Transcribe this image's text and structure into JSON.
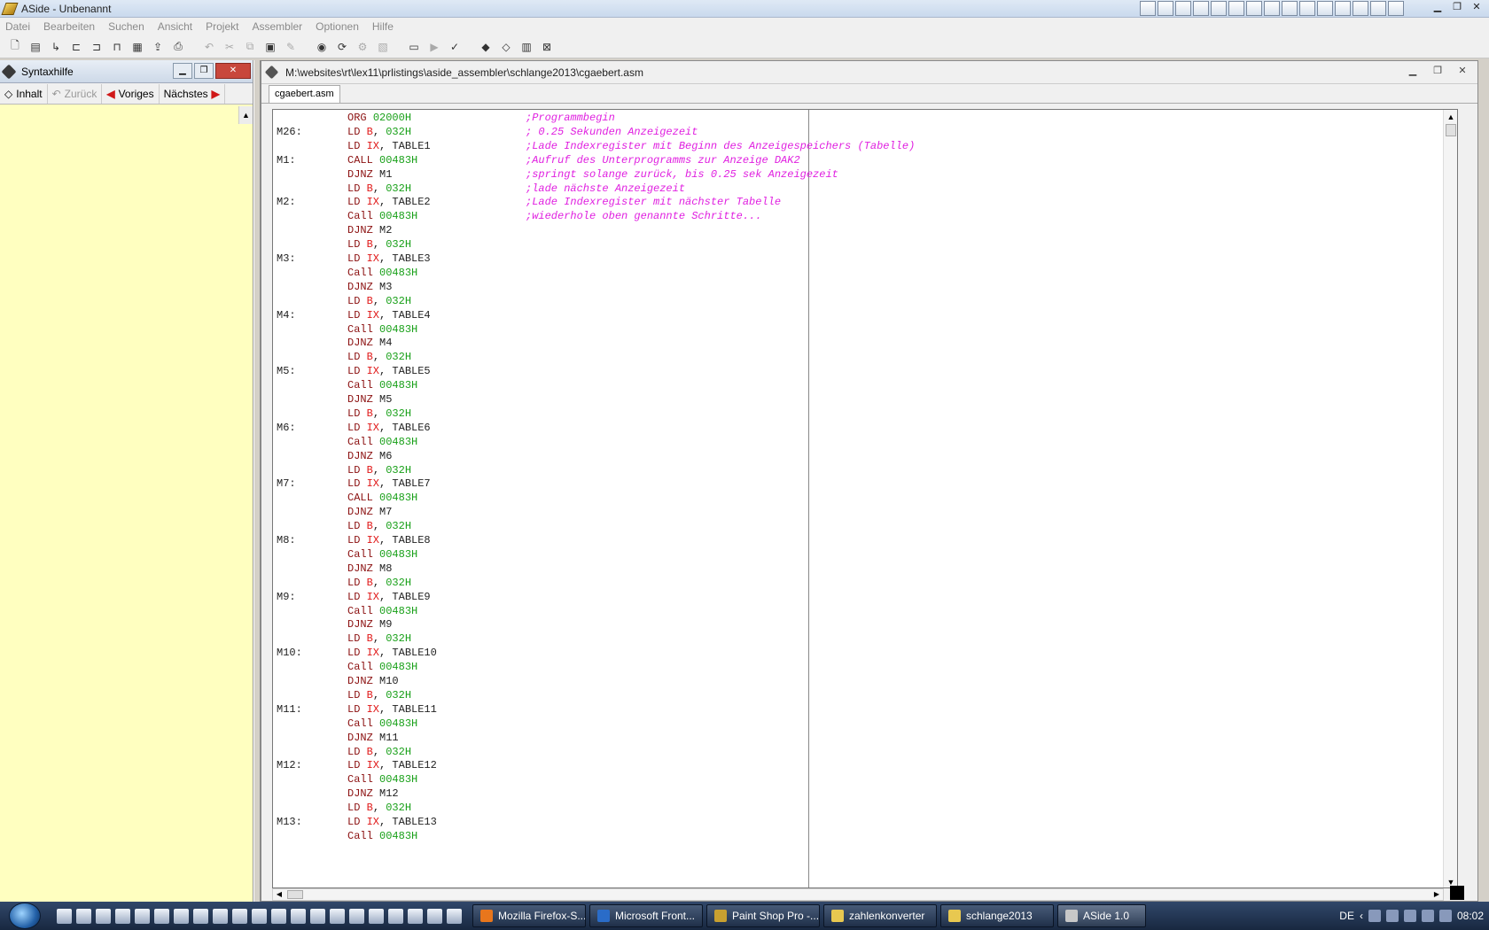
{
  "window": {
    "title": "ASide - Unbenannt"
  },
  "menu": [
    "Datei",
    "Bearbeiten",
    "Suchen",
    "Ansicht",
    "Projekt",
    "Assembler",
    "Optionen",
    "Hilfe"
  ],
  "syntax_panel": {
    "title": "Syntaxhilfe",
    "nav": {
      "contents": "Inhalt",
      "back": "Zurück",
      "previous": "Voriges",
      "next": "Nächstes"
    }
  },
  "editor": {
    "path": "M:\\websites\\rt\\lex11\\prlistings\\aside_assembler\\schlange2013\\cgaebert.asm",
    "tab": "cgaebert.asm",
    "lines": [
      {
        "label": "",
        "op": "ORG",
        "args": [
          {
            "t": "02000H",
            "c": "num"
          }
        ],
        "comment": ";Programmbegin"
      },
      {
        "label": "M26:",
        "op": "LD",
        "args": [
          {
            "t": "B",
            "c": "reg"
          },
          {
            "t": ", ",
            "c": "op"
          },
          {
            "t": "032H",
            "c": "num"
          }
        ],
        "comment": "; 0.25 Sekunden Anzeigezeit"
      },
      {
        "label": "",
        "op": "LD",
        "args": [
          {
            "t": "IX",
            "c": "reg"
          },
          {
            "t": ", TABLE1",
            "c": "op"
          }
        ],
        "comment": ";Lade Indexregister mit Beginn des Anzeigespeichers (Tabelle)"
      },
      {
        "label": "M1:",
        "op": "CALL",
        "args": [
          {
            "t": "00483H",
            "c": "num"
          }
        ],
        "comment": ";Aufruf des Unterprogramms zur Anzeige DAK2"
      },
      {
        "label": "",
        "op": "DJNZ",
        "args": [
          {
            "t": "M1",
            "c": "op"
          }
        ],
        "comment": ";springt solange zurück, bis 0.25 sek Anzeigezeit"
      },
      {
        "label": "",
        "op": "LD",
        "args": [
          {
            "t": "B",
            "c": "reg"
          },
          {
            "t": ", ",
            "c": "op"
          },
          {
            "t": "032H",
            "c": "num"
          }
        ],
        "comment": ";lade nächste Anzeigezeit"
      },
      {
        "label": "M2:",
        "op": "LD",
        "args": [
          {
            "t": "IX",
            "c": "reg"
          },
          {
            "t": ", TABLE2",
            "c": "op"
          }
        ],
        "comment": ";Lade Indexregister mit nächster Tabelle"
      },
      {
        "label": "",
        "op": "Call",
        "args": [
          {
            "t": "00483H",
            "c": "num"
          }
        ],
        "comment": ";wiederhole oben genannte Schritte..."
      },
      {
        "label": "",
        "op": "DJNZ",
        "args": [
          {
            "t": "M2",
            "c": "op"
          }
        ],
        "comment": ""
      },
      {
        "label": "",
        "op": "LD",
        "args": [
          {
            "t": "B",
            "c": "reg"
          },
          {
            "t": ", ",
            "c": "op"
          },
          {
            "t": "032H",
            "c": "num"
          }
        ],
        "comment": ""
      },
      {
        "label": "M3:",
        "op": "LD",
        "args": [
          {
            "t": "IX",
            "c": "reg"
          },
          {
            "t": ", TABLE3",
            "c": "op"
          }
        ],
        "comment": ""
      },
      {
        "label": "",
        "op": "Call",
        "args": [
          {
            "t": "00483H",
            "c": "num"
          }
        ],
        "comment": ""
      },
      {
        "label": "",
        "op": "DJNZ",
        "args": [
          {
            "t": "M3",
            "c": "op"
          }
        ],
        "comment": ""
      },
      {
        "label": "",
        "op": "LD",
        "args": [
          {
            "t": "B",
            "c": "reg"
          },
          {
            "t": ", ",
            "c": "op"
          },
          {
            "t": "032H",
            "c": "num"
          }
        ],
        "comment": ""
      },
      {
        "label": "M4:",
        "op": "LD",
        "args": [
          {
            "t": "IX",
            "c": "reg"
          },
          {
            "t": ", TABLE4",
            "c": "op"
          }
        ],
        "comment": ""
      },
      {
        "label": "",
        "op": "Call",
        "args": [
          {
            "t": "00483H",
            "c": "num"
          }
        ],
        "comment": ""
      },
      {
        "label": "",
        "op": "DJNZ",
        "args": [
          {
            "t": "M4",
            "c": "op"
          }
        ],
        "comment": ""
      },
      {
        "label": "",
        "op": "LD",
        "args": [
          {
            "t": "B",
            "c": "reg"
          },
          {
            "t": ", ",
            "c": "op"
          },
          {
            "t": "032H",
            "c": "num"
          }
        ],
        "comment": ""
      },
      {
        "label": "M5:",
        "op": "LD",
        "args": [
          {
            "t": "IX",
            "c": "reg"
          },
          {
            "t": ", TABLE5",
            "c": "op"
          }
        ],
        "comment": ""
      },
      {
        "label": "",
        "op": "Call",
        "args": [
          {
            "t": "00483H",
            "c": "num"
          }
        ],
        "comment": ""
      },
      {
        "label": "",
        "op": "DJNZ",
        "args": [
          {
            "t": "M5",
            "c": "op"
          }
        ],
        "comment": ""
      },
      {
        "label": "",
        "op": "LD",
        "args": [
          {
            "t": "B",
            "c": "reg"
          },
          {
            "t": ", ",
            "c": "op"
          },
          {
            "t": "032H",
            "c": "num"
          }
        ],
        "comment": ""
      },
      {
        "label": "M6:",
        "op": "LD",
        "args": [
          {
            "t": "IX",
            "c": "reg"
          },
          {
            "t": ", TABLE6",
            "c": "op"
          }
        ],
        "comment": ""
      },
      {
        "label": "",
        "op": "Call",
        "args": [
          {
            "t": "00483H",
            "c": "num"
          }
        ],
        "comment": ""
      },
      {
        "label": "",
        "op": "DJNZ",
        "args": [
          {
            "t": "M6",
            "c": "op"
          }
        ],
        "comment": ""
      },
      {
        "label": "",
        "op": "LD",
        "args": [
          {
            "t": "B",
            "c": "reg"
          },
          {
            "t": ", ",
            "c": "op"
          },
          {
            "t": "032H",
            "c": "num"
          }
        ],
        "comment": ""
      },
      {
        "label": "M7:",
        "op": "LD",
        "args": [
          {
            "t": "IX",
            "c": "reg"
          },
          {
            "t": ", TABLE7",
            "c": "op"
          }
        ],
        "comment": ""
      },
      {
        "label": "",
        "op": "CALL",
        "args": [
          {
            "t": "00483H",
            "c": "num"
          }
        ],
        "comment": ""
      },
      {
        "label": "",
        "op": "DJNZ",
        "args": [
          {
            "t": "M7",
            "c": "op"
          }
        ],
        "comment": ""
      },
      {
        "label": "",
        "op": "LD",
        "args": [
          {
            "t": "B",
            "c": "reg"
          },
          {
            "t": ", ",
            "c": "op"
          },
          {
            "t": "032H",
            "c": "num"
          }
        ],
        "comment": ""
      },
      {
        "label": "M8:",
        "op": "LD",
        "args": [
          {
            "t": "IX",
            "c": "reg"
          },
          {
            "t": ", TABLE8",
            "c": "op"
          }
        ],
        "comment": ""
      },
      {
        "label": "",
        "op": "Call",
        "args": [
          {
            "t": "00483H",
            "c": "num"
          }
        ],
        "comment": ""
      },
      {
        "label": "",
        "op": "DJNZ",
        "args": [
          {
            "t": "M8",
            "c": "op"
          }
        ],
        "comment": ""
      },
      {
        "label": "",
        "op": "LD",
        "args": [
          {
            "t": "B",
            "c": "reg"
          },
          {
            "t": ", ",
            "c": "op"
          },
          {
            "t": "032H",
            "c": "num"
          }
        ],
        "comment": ""
      },
      {
        "label": "M9:",
        "op": "LD",
        "args": [
          {
            "t": "IX",
            "c": "reg"
          },
          {
            "t": ", TABLE9",
            "c": "op"
          }
        ],
        "comment": ""
      },
      {
        "label": "",
        "op": "Call",
        "args": [
          {
            "t": "00483H",
            "c": "num"
          }
        ],
        "comment": ""
      },
      {
        "label": "",
        "op": "DJNZ",
        "args": [
          {
            "t": "M9",
            "c": "op"
          }
        ],
        "comment": ""
      },
      {
        "label": "",
        "op": "LD",
        "args": [
          {
            "t": "B",
            "c": "reg"
          },
          {
            "t": ", ",
            "c": "op"
          },
          {
            "t": "032H",
            "c": "num"
          }
        ],
        "comment": ""
      },
      {
        "label": "M10:",
        "op": "LD",
        "args": [
          {
            "t": "IX",
            "c": "reg"
          },
          {
            "t": ", TABLE10",
            "c": "op"
          }
        ],
        "comment": ""
      },
      {
        "label": "",
        "op": "Call",
        "args": [
          {
            "t": "00483H",
            "c": "num"
          }
        ],
        "comment": ""
      },
      {
        "label": "",
        "op": "DJNZ",
        "args": [
          {
            "t": "M10",
            "c": "op"
          }
        ],
        "comment": ""
      },
      {
        "label": "",
        "op": "LD",
        "args": [
          {
            "t": "B",
            "c": "reg"
          },
          {
            "t": ", ",
            "c": "op"
          },
          {
            "t": "032H",
            "c": "num"
          }
        ],
        "comment": ""
      },
      {
        "label": "M11:",
        "op": "LD",
        "args": [
          {
            "t": "IX",
            "c": "reg"
          },
          {
            "t": ", TABLE11",
            "c": "op"
          }
        ],
        "comment": ""
      },
      {
        "label": "",
        "op": "Call",
        "args": [
          {
            "t": "00483H",
            "c": "num"
          }
        ],
        "comment": ""
      },
      {
        "label": "",
        "op": "DJNZ",
        "args": [
          {
            "t": "M11",
            "c": "op"
          }
        ],
        "comment": ""
      },
      {
        "label": "",
        "op": "LD",
        "args": [
          {
            "t": "B",
            "c": "reg"
          },
          {
            "t": ", ",
            "c": "op"
          },
          {
            "t": "032H",
            "c": "num"
          }
        ],
        "comment": ""
      },
      {
        "label": "M12:",
        "op": "LD",
        "args": [
          {
            "t": "IX",
            "c": "reg"
          },
          {
            "t": ", TABLE12",
            "c": "op"
          }
        ],
        "comment": ""
      },
      {
        "label": "",
        "op": "Call",
        "args": [
          {
            "t": "00483H",
            "c": "num"
          }
        ],
        "comment": ""
      },
      {
        "label": "",
        "op": "DJNZ",
        "args": [
          {
            "t": "M12",
            "c": "op"
          }
        ],
        "comment": ""
      },
      {
        "label": "",
        "op": "LD",
        "args": [
          {
            "t": "B",
            "c": "reg"
          },
          {
            "t": ", ",
            "c": "op"
          },
          {
            "t": "032H",
            "c": "num"
          }
        ],
        "comment": ""
      },
      {
        "label": "M13:",
        "op": "LD",
        "args": [
          {
            "t": "IX",
            "c": "reg"
          },
          {
            "t": ", TABLE13",
            "c": "op"
          }
        ],
        "comment": ""
      },
      {
        "label": "",
        "op": "Call",
        "args": [
          {
            "t": "00483H",
            "c": "num"
          }
        ],
        "comment": ""
      }
    ]
  },
  "taskbar": {
    "tasks": [
      {
        "label": "Mozilla Firefox-S...",
        "icon": "firefox-icon",
        "color": "#e8761c"
      },
      {
        "label": "Microsoft Front...",
        "icon": "frontpage-icon",
        "color": "#2a6cc8"
      },
      {
        "label": "Paint Shop Pro -...",
        "icon": "paint-icon",
        "color": "#c8a030"
      },
      {
        "label": "zahlenkonverter",
        "icon": "folder-icon",
        "color": "#e8c850"
      },
      {
        "label": "schlange2013",
        "icon": "folder-icon",
        "color": "#e8c850"
      },
      {
        "label": "ASide 1.0",
        "icon": "aside-icon",
        "color": "#c8c8c8"
      }
    ],
    "lang": "DE",
    "clock": "08:02"
  },
  "colors": {
    "keyword": "#8b1010",
    "register": "#e01818",
    "number": "#18a018",
    "comment": "#e020e0",
    "panel_bg": "#ffffc0"
  }
}
